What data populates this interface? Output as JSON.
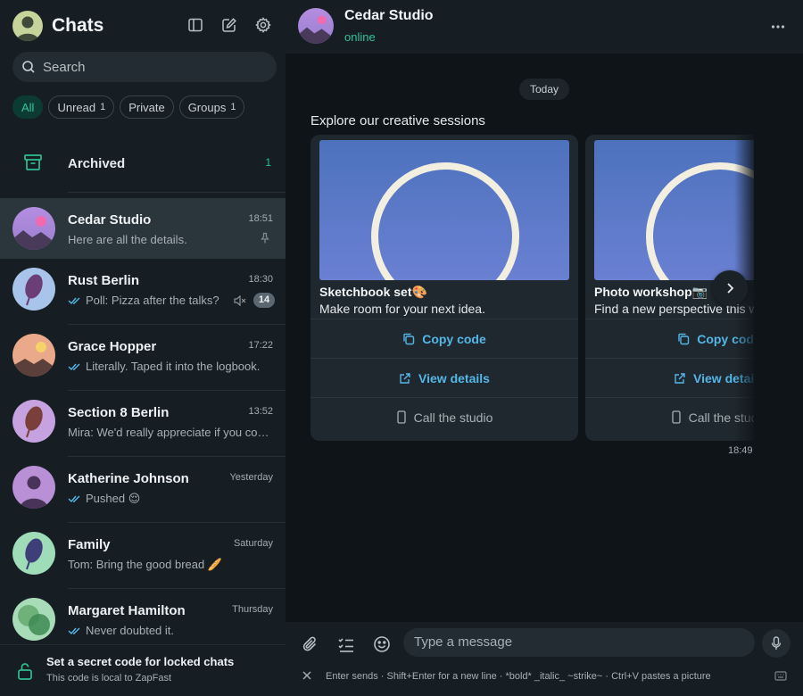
{
  "colors": {
    "accent": "#35c39b",
    "link": "#53b7e8",
    "sidebar_bg": "#161d23",
    "main_bg": "#0f1419",
    "selected_row": "#2b353c"
  },
  "sidebar": {
    "title": "Chats",
    "icons": [
      "sidebar-toggle-icon",
      "compose-icon",
      "gear-icon"
    ],
    "search_placeholder": "Search",
    "filters": [
      {
        "label": "All",
        "count": "",
        "active": true
      },
      {
        "label": "Unread",
        "count": "1",
        "active": false
      },
      {
        "label": "Private",
        "count": "",
        "active": false
      },
      {
        "label": "Groups",
        "count": "1",
        "active": false
      }
    ],
    "archived": {
      "label": "Archived",
      "count": "1"
    },
    "chats": [
      {
        "name": "Cedar Studio",
        "time": "18:51",
        "preview": "Here are all the details.",
        "pinned": true,
        "selected": true
      },
      {
        "name": "Rust Berlin",
        "time": "18:30",
        "preview": "Poll: Pizza after the talks?",
        "read": true,
        "muted": true,
        "unread": "14"
      },
      {
        "name": "Grace Hopper",
        "time": "17:22",
        "preview": "Literally. Taped it into the logbook.",
        "read": true
      },
      {
        "name": "Section 8 Berlin",
        "time": "13:52",
        "preview": "Mira: We'd really appreciate if you could",
        "read": false
      },
      {
        "name": "Katherine Johnson",
        "time": "Yesterday",
        "preview": "Pushed 😌",
        "read": true
      },
      {
        "name": "Family",
        "time": "Saturday",
        "preview": "Tom: Bring the good bread 🥖",
        "read": false
      },
      {
        "name": "Margaret Hamilton",
        "time": "Thursday",
        "preview": "Never doubted it.",
        "read": true
      }
    ],
    "locked": {
      "title": "Set a secret code for locked chats",
      "subtitle": "This code is local to ZapFast"
    }
  },
  "conversation": {
    "name": "Cedar Studio",
    "status": "online",
    "date_label": "Today",
    "carousel_title": "Explore our creative sessions",
    "cards": [
      {
        "title": "Sketchbook set🎨",
        "description": "Make room for your next idea.",
        "buttons": [
          "Copy code",
          "View details",
          "Call the studio"
        ]
      },
      {
        "title": "Photo workshop📷",
        "description": "Find a new perspective this weekend.",
        "buttons": [
          "Copy code",
          "View details",
          "Call the studio"
        ]
      }
    ],
    "message_time": "18:49"
  },
  "composer": {
    "placeholder": "Type a message",
    "hint": "Enter sends · Shift+Enter for a new line · *bold* _italic_ ~strike~ · Ctrl+V pastes a picture"
  }
}
